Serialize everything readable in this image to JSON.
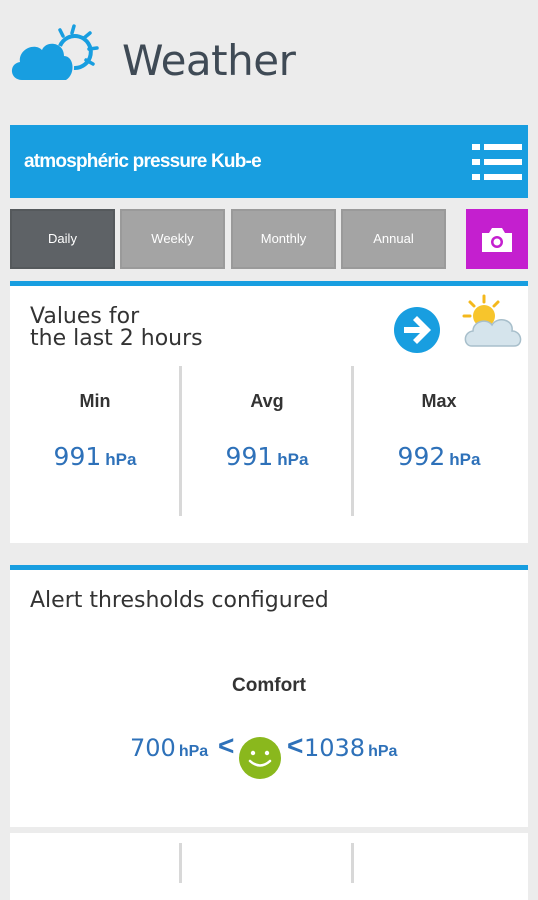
{
  "app": {
    "title": "Weather",
    "logo_icon": "cloud-sun-icon"
  },
  "title_bar": {
    "text": "atmosphéric pressure Kub-e",
    "menu_icon": "menu-list-icon"
  },
  "tabs": [
    {
      "label": "Daily",
      "active": true
    },
    {
      "label": "Weekly",
      "active": false
    },
    {
      "label": "Monthly",
      "active": false
    },
    {
      "label": "Annual",
      "active": false
    }
  ],
  "camera": {
    "icon": "camera-icon",
    "color": "#c41fcf"
  },
  "values_card": {
    "title_line1": "Values for",
    "title_line2": "the last 2 hours",
    "nav_icon": "arrow-right-circle-icon",
    "weather_icon": "sun-behind-cloud-icon",
    "stats": [
      {
        "label": "Min",
        "value": "991",
        "unit": "hPa"
      },
      {
        "label": "Avg",
        "value": "991",
        "unit": "hPa"
      },
      {
        "label": "Max",
        "value": "992",
        "unit": "hPa"
      }
    ]
  },
  "alerts_card": {
    "title": "Alert thresholds configured",
    "comfort_label": "Comfort",
    "low": {
      "value": "700",
      "unit": "hPa"
    },
    "high": {
      "value": "1038",
      "unit": "hPa"
    },
    "lt_symbol": "<",
    "status_icon": "smiley-face-icon"
  },
  "colors": {
    "accent": "#189ee0",
    "value_text": "#2e71b9",
    "smiley": "#8ab81d",
    "active_tab": "#5e6266"
  }
}
